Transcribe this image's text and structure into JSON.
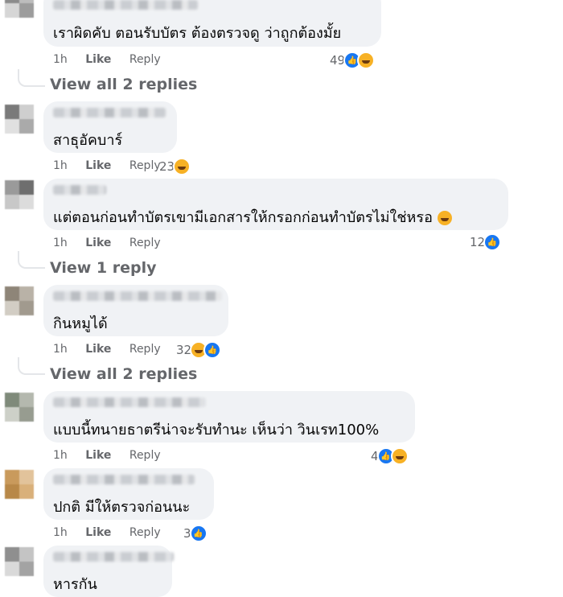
{
  "comments": [
    {
      "text": "เราผิดคับ ตอนรับบัตร ต้องตรวจดู ว่าถูกต้องมั้ย",
      "time": "1h",
      "like": "Like",
      "reply": "Reply",
      "reactions": "49",
      "reaction_icons": [
        "like-icon",
        "haha-icon"
      ],
      "view_replies": "View all 2 replies"
    },
    {
      "text": "สาธุอัคบาร์",
      "time": "1h",
      "like": "Like",
      "reply": "Reply",
      "reactions": "23",
      "reaction_icons": [
        "haha-icon"
      ]
    },
    {
      "text": "แต่ตอนก่อนทำบัตรเขามีเอกสารให้กรอกก่อนทำบัตรไม่ใช่หรอ",
      "emoji": "rofl-emoji",
      "time": "1h",
      "like": "Like",
      "reply": "Reply",
      "reactions": "12",
      "reaction_icons": [
        "like-icon"
      ],
      "view_replies": "View 1 reply"
    },
    {
      "text": "กินหมูได้",
      "time": "1h",
      "like": "Like",
      "reply": "Reply",
      "reactions": "32",
      "reaction_icons": [
        "haha-icon",
        "like-icon"
      ],
      "view_replies": "View all 2 replies"
    },
    {
      "text": "แบบนี้ทนายธาตรีน่าจะรับทำนะ เห็นว่า วินเรท100%",
      "time": "1h",
      "like": "Like",
      "reply": "Reply",
      "reactions": "4",
      "reaction_icons": [
        "like-icon",
        "haha-icon"
      ]
    },
    {
      "text": "ปกติ มีให้ตรวจก่อนนะ",
      "time": "1h",
      "like": "Like",
      "reply": "Reply",
      "reactions": "3",
      "reaction_icons": [
        "like-icon"
      ]
    },
    {
      "text": "หารกัน"
    }
  ]
}
